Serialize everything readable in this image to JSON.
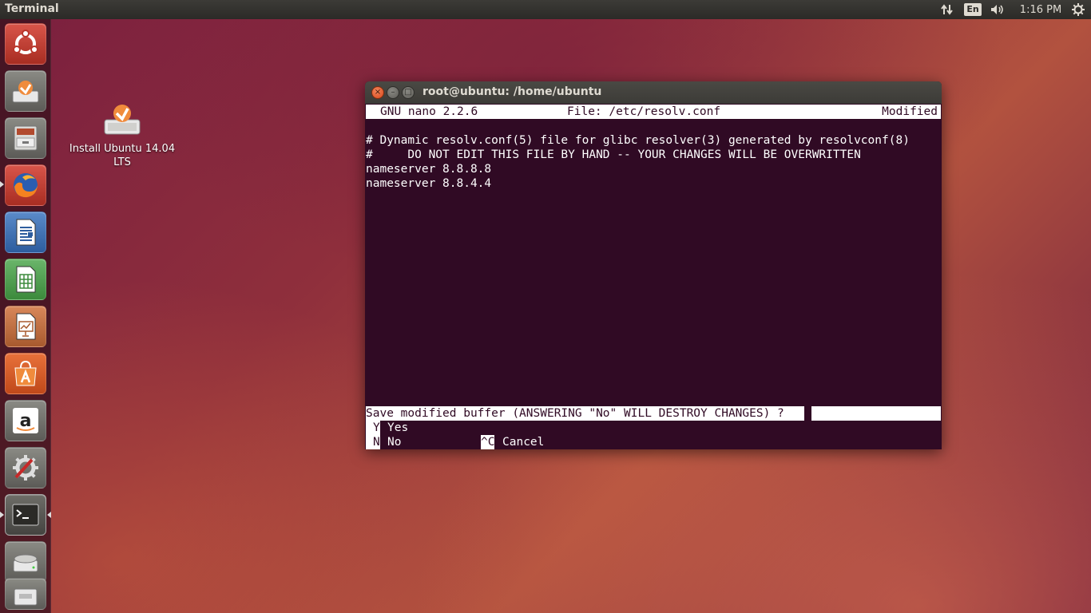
{
  "top_panel": {
    "app_title": "Terminal",
    "keyboard_layout": "En",
    "clock": "1:16 PM",
    "icons": [
      "network-icon",
      "keyboard-layout-icon",
      "sound-icon",
      "gear-icon"
    ]
  },
  "launcher": {
    "items": [
      {
        "name": "dash-home",
        "icon": "ubuntu-logo-icon"
      },
      {
        "name": "install-ubuntu",
        "icon": "install-ubuntu-icon"
      },
      {
        "name": "files",
        "icon": "file-cabinet-icon"
      },
      {
        "name": "firefox",
        "icon": "firefox-icon"
      },
      {
        "name": "libreoffice-writer",
        "icon": "writer-icon"
      },
      {
        "name": "libreoffice-calc",
        "icon": "calc-icon"
      },
      {
        "name": "libreoffice-impress",
        "icon": "impress-icon"
      },
      {
        "name": "ubuntu-software-center",
        "icon": "software-center-icon"
      },
      {
        "name": "amazon",
        "icon": "amazon-icon"
      },
      {
        "name": "system-settings",
        "icon": "settings-icon"
      },
      {
        "name": "terminal",
        "icon": "terminal-icon"
      },
      {
        "name": "drive",
        "icon": "drive-icon"
      },
      {
        "name": "trash",
        "icon": "trash-icon"
      }
    ]
  },
  "desktop": {
    "install_icon_label": "Install Ubuntu 14.04 LTS"
  },
  "window": {
    "title": "root@ubuntu: /home/ubuntu",
    "close_glyph": "×",
    "minimize_glyph": "–",
    "maximize_glyph": "□"
  },
  "nano": {
    "header": {
      "version": "GNU nano 2.2.6",
      "file": "File: /etc/resolv.conf",
      "status": "Modified"
    },
    "lines": [
      "# Dynamic resolv.conf(5) file for glibc resolver(3) generated by resolvconf(8)",
      "#     DO NOT EDIT THIS FILE BY HAND -- YOUR CHANGES WILL BE OVERWRITTEN",
      "nameserver 8.8.8.8",
      "nameserver 8.8.4.4"
    ],
    "prompt": "Save modified buffer (ANSWERING \"No\" WILL DESTROY CHANGES) ? ",
    "options": {
      "yes_key": "Y",
      "yes_label": "Yes",
      "no_key": "N",
      "no_label": "No",
      "cancel_key": "^C",
      "cancel_label": "Cancel"
    }
  },
  "colors": {
    "terminal_bg": "#300a24",
    "panel_bg": "#3c3b37",
    "close_button": "#e95420"
  }
}
